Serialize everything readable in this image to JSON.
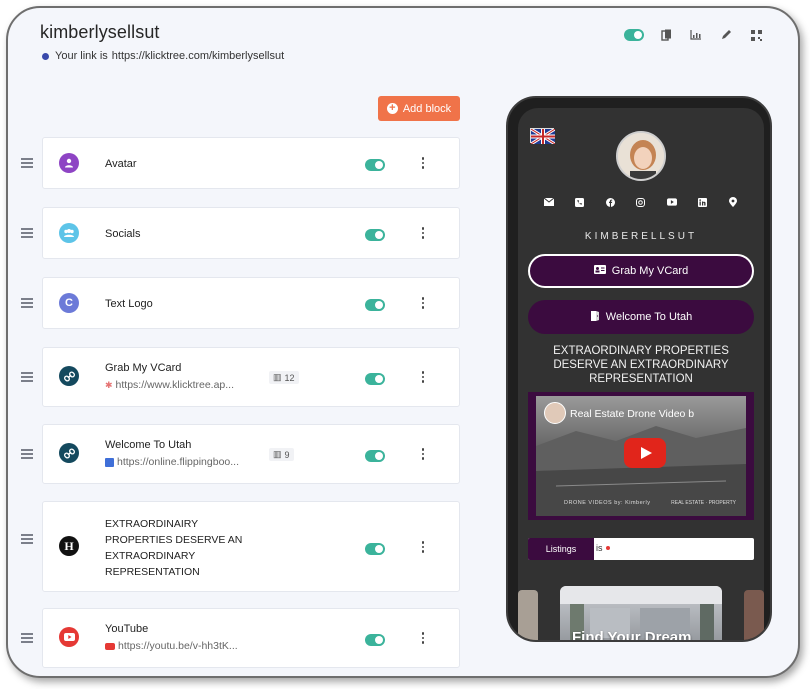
{
  "header": {
    "title": "kimberlysellsut",
    "link_prefix": "Your link is ",
    "link_url": "https://klicktree.com/kimberlysellsut"
  },
  "toolbar": {
    "icons": [
      "toggle-switch",
      "copy-icon",
      "analytics-icon",
      "edit-icon",
      "qr-icon"
    ]
  },
  "add_block_label": "Add block",
  "blocks": [
    {
      "label": "Avatar",
      "icon": "user-icon",
      "icon_color": "#8e44c4",
      "enabled": true
    },
    {
      "label": "Socials",
      "icon": "group-icon",
      "icon_color": "#5dc4e8",
      "enabled": true
    },
    {
      "label": "Text Logo",
      "icon": "c-letter-icon",
      "icon_color": "#6c7ad8",
      "enabled": true
    },
    {
      "label": "Grab My VCard",
      "icon": "link-icon",
      "icon_color": "#14495e",
      "sub": "https://www.klicktree.ap...",
      "count": "12",
      "enabled": true
    },
    {
      "label": "Welcome To Utah",
      "icon": "link-icon",
      "icon_color": "#14495e",
      "sub": "https://online.flippingboo...",
      "count": "9",
      "enabled": true
    },
    {
      "label_lines": [
        "EXTRAORDINAIRY",
        "PROPERTIES DESERVE AN",
        "EXTRAORDINARY",
        "REPRESENTATION"
      ],
      "icon": "h-letter-icon",
      "icon_color": "#111111",
      "enabled": true
    },
    {
      "label": "YouTube",
      "icon": "youtube-icon",
      "icon_color": "#e53935",
      "sub": "https://youtu.be/v-hh3tK...",
      "enabled": true
    }
  ],
  "preview": {
    "name": "KIMBERELLSUT",
    "social_icons": [
      "email-icon",
      "phone-icon",
      "facebook-icon",
      "instagram-icon",
      "youtube-icon",
      "linkedin-icon",
      "location-icon"
    ],
    "button1": "Grab My VCard",
    "button2": "Welcome To Utah",
    "headline": "EXTRAORDINARY PROPERTIES DESERVE AN EXTRAORDINARY REPRESENTATION",
    "video_title": "Real Estate Drone Video b",
    "video_footer": "DRONE VIDEOS by: Kimberly",
    "video_footer_right": "REAL ESTATE · PROPERTY",
    "listings_tab": "Listings",
    "listings_rest": "is",
    "carousel_caption": "Find Your Dream"
  },
  "colors": {
    "accent": "#f07349",
    "toggle": "#3bb39b",
    "brand_purple": "#3b0b3f"
  }
}
